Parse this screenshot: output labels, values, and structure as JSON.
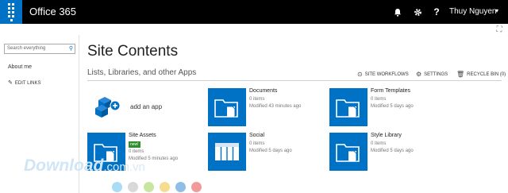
{
  "topbar": {
    "brand": "Office 365",
    "user_name": "Thuy Nguyen",
    "icons": [
      "app-launcher-icon",
      "bell-icon",
      "gear-icon",
      "help-icon"
    ],
    "colors": {
      "bar": "#000000",
      "app_launcher": "#0072c6"
    }
  },
  "leftnav": {
    "search_placeholder": "Search everything",
    "items": [
      {
        "label": "About me"
      },
      {
        "label": "EDIT LINKS"
      }
    ]
  },
  "main": {
    "title": "Site Contents",
    "section": "Lists, Libraries, and other Apps",
    "commands": {
      "workflows": "SITE WORKFLOWS",
      "settings": "SETTINGS",
      "recycle": "RECYCLE BIN (0)"
    },
    "add_app": "add an app",
    "tiles": [
      {
        "name": "Documents",
        "items": "0 items",
        "modified": "Modified 43 minutes ago",
        "icon": "document-library-icon"
      },
      {
        "name": "Form Templates",
        "items": "0 items",
        "modified": "Modified 5 days ago",
        "icon": "document-library-icon"
      },
      {
        "name": "Site Assets",
        "badge": "new!",
        "items": "0 items",
        "modified": "Modified 5 minutes ago",
        "icon": "document-library-icon"
      },
      {
        "name": "Social",
        "items": "0 items",
        "modified": "Modified 5 days ago",
        "icon": "list-icon"
      },
      {
        "name": "Style Library",
        "items": "0 items",
        "modified": "Modified 5 days ago",
        "icon": "document-library-icon"
      }
    ],
    "tile_color": "#0072c6"
  },
  "watermark": {
    "text": "Download",
    "tld": ".com.vn",
    "circle_colors": [
      "#a9dcf5",
      "#d9d9d9",
      "#c8e6a0",
      "#f7dc8f",
      "#8fbfe6",
      "#f29a9a"
    ]
  }
}
